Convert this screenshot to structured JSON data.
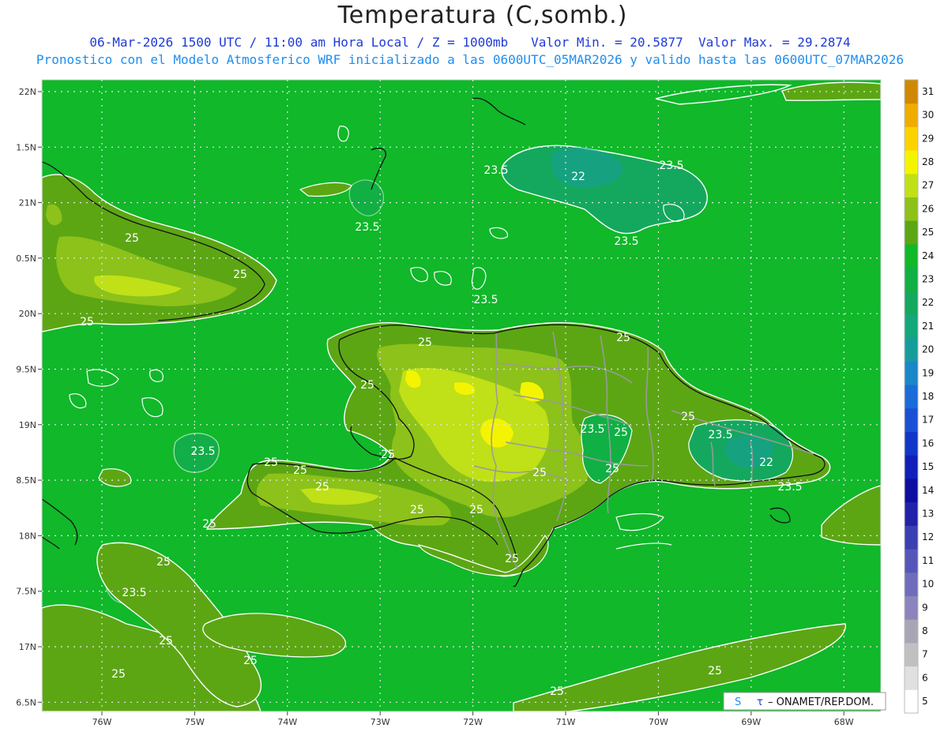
{
  "header": {
    "title": "Temperatura (C,somb.)",
    "valid_line": "06-Mar-2026 1500 UTC / 11:00 am Hora Local / Z = 1000mb",
    "min_label": "Valor Min. = 20.5877",
    "max_label": "Valor Max. = 29.2874",
    "model_line": "Pronostico con el Modelo Atmosferico WRF inicializado a las 0600UTC_05MAR2026 y valido hasta las  0600UTC_07MAR2026"
  },
  "axes": {
    "lat_ticks": [
      "22N",
      "1.5N",
      "21N",
      "0.5N",
      "20N",
      "9.5N",
      "19N",
      "8.5N",
      "18N",
      "7.5N",
      "17N",
      "6.5N"
    ],
    "lon_ticks": [
      "76W",
      "75W",
      "74W",
      "73W",
      "72W",
      "71W",
      "70W",
      "69W",
      "68W"
    ]
  },
  "colorbar": {
    "labels": [
      "5",
      "6",
      "7",
      "8",
      "9",
      "10",
      "11",
      "12",
      "13",
      "14",
      "15",
      "16",
      "17",
      "18",
      "19",
      "20",
      "21",
      "22",
      "23",
      "24",
      "25",
      "26",
      "27",
      "28",
      "29",
      "30",
      "31"
    ],
    "colors": [
      "#ffffff",
      "#e0e0e0",
      "#c0c0c0",
      "#a7a7b4",
      "#8c84bc",
      "#6f6cbb",
      "#5557b8",
      "#3a3fb2",
      "#2121a9",
      "#0e0ea0",
      "#1020b8",
      "#1236c8",
      "#1a50d6",
      "#1b6bd8",
      "#1a87c8",
      "#179c9c",
      "#12a87a",
      "#14a85e",
      "#10b044",
      "#10b82a",
      "#5ca614",
      "#8cc21a",
      "#c0e018",
      "#f4f400",
      "#fcd200",
      "#f0ac00",
      "#d08800"
    ]
  },
  "contour_labels": [
    {
      "text": "23.5"
    },
    {
      "text": "22"
    },
    {
      "text": "23.5"
    },
    {
      "text": "23.5"
    },
    {
      "text": "23.5"
    },
    {
      "text": "23.5"
    },
    {
      "text": "25"
    },
    {
      "text": "25"
    },
    {
      "text": "25"
    },
    {
      "text": "25"
    },
    {
      "text": "25"
    },
    {
      "text": "25"
    },
    {
      "text": "23.5"
    },
    {
      "text": "25"
    },
    {
      "text": "25"
    },
    {
      "text": "25"
    },
    {
      "text": "25"
    },
    {
      "text": "25"
    },
    {
      "text": "25"
    },
    {
      "text": "23.5"
    },
    {
      "text": "25"
    },
    {
      "text": "25"
    },
    {
      "text": "23.5"
    },
    {
      "text": "22"
    },
    {
      "text": "23.5"
    },
    {
      "text": "25"
    },
    {
      "text": "25"
    },
    {
      "text": "25"
    },
    {
      "text": "23.5"
    },
    {
      "text": "25"
    },
    {
      "text": "25"
    },
    {
      "text": "25"
    },
    {
      "text": "25"
    },
    {
      "text": "25"
    },
    {
      "text": "25"
    },
    {
      "text": "25"
    }
  ],
  "credit": {
    "symbol_s": "S",
    "symbol_tau": "τ",
    "text": "– ONAMET/REP.DOM."
  },
  "colors": {
    "ocean": "#10b82a",
    "coastal": "#5ca614",
    "land_warm": "#8cc21a",
    "land_hot": "#c0e018",
    "hotspot": "#f4f400",
    "cool": "#10b044",
    "cooler": "#14a85e",
    "title_blue": "#1f3bd8",
    "sub_blue": "#1e8ef0"
  }
}
